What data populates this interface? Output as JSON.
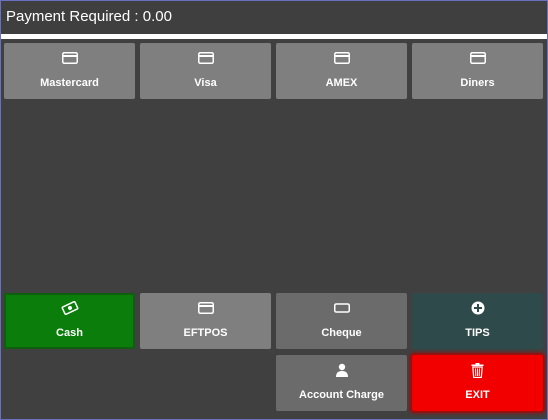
{
  "header": {
    "title": "Payment Required : 0.00"
  },
  "cards": [
    {
      "label": "Mastercard",
      "icon": "credit-card-icon"
    },
    {
      "label": "Visa",
      "icon": "credit-card-icon"
    },
    {
      "label": "AMEX",
      "icon": "credit-card-icon"
    },
    {
      "label": "Diners",
      "icon": "credit-card-icon"
    }
  ],
  "tenders": [
    {
      "label": "Cash",
      "icon": "cash-icon",
      "color": "#0a7d0a"
    },
    {
      "label": "EFTPOS",
      "icon": "credit-card-icon",
      "color": "#7f7f7f"
    },
    {
      "label": "Cheque",
      "icon": "cheque-icon",
      "color": "#6b6b6b"
    },
    {
      "label": "TIPS",
      "icon": "plus-circle-icon",
      "color": "#2e4a4a"
    }
  ],
  "actions": [
    {
      "label": "Account Charge",
      "icon": "user-icon",
      "color": "#6b6b6b"
    },
    {
      "label": "EXIT",
      "icon": "trash-icon",
      "color": "#f20000"
    }
  ]
}
